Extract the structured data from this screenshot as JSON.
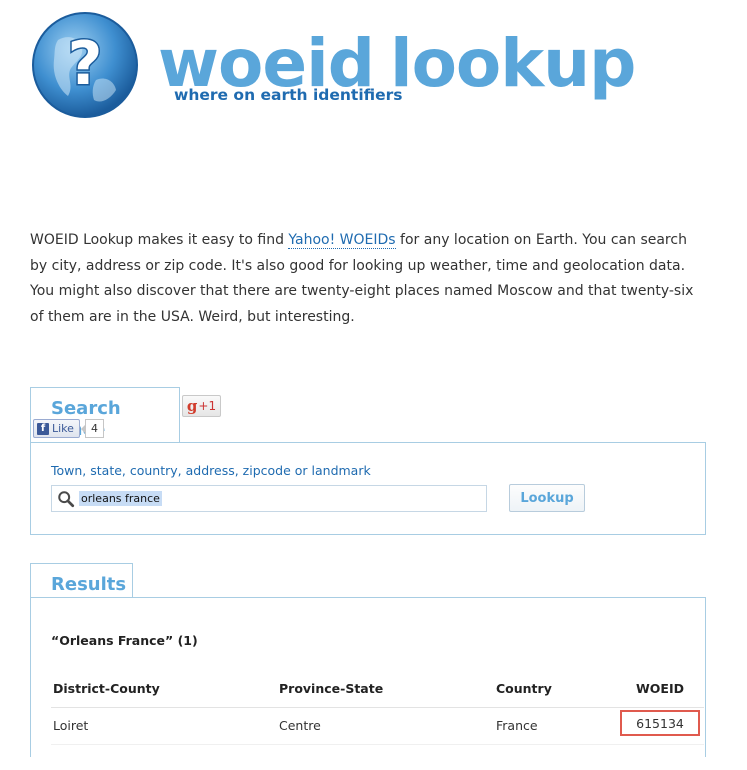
{
  "header": {
    "logo_title_part1": "woeid",
    "logo_title_part2": "lookup",
    "tagline": "where on earth identifiers",
    "brand_color": "#5aa6da",
    "logo_icon": "globe-question-icon"
  },
  "intro": {
    "text_before_link": "WOEID Lookup makes it easy to find ",
    "link_text": "Yahoo! WOEIDs",
    "text_after_link": " for any location on Earth. You can search by city, address or zip code. It's also good for looking up weather, time and geolocation data. You might also discover that there are twenty-eight places named Moscow and that twenty-six of them are in the USA. Weird, but interesting."
  },
  "search": {
    "tab_label": "Search Place",
    "gplus_label": "+1",
    "fb_like_label": "Like",
    "fb_like_count": "4",
    "field_label": "Town, state, country, address, zipcode or landmark",
    "input_value": "orleans  france",
    "button_label": "Lookup"
  },
  "results": {
    "tab_label": "Results",
    "query_summary": "“Orleans France” (1)",
    "columns": [
      "District-County",
      "Province-State",
      "Country",
      "WOEID"
    ],
    "rows": [
      [
        "Loiret",
        "Centre",
        "France",
        "615134"
      ]
    ],
    "highlight_color": "#e05a4e"
  }
}
